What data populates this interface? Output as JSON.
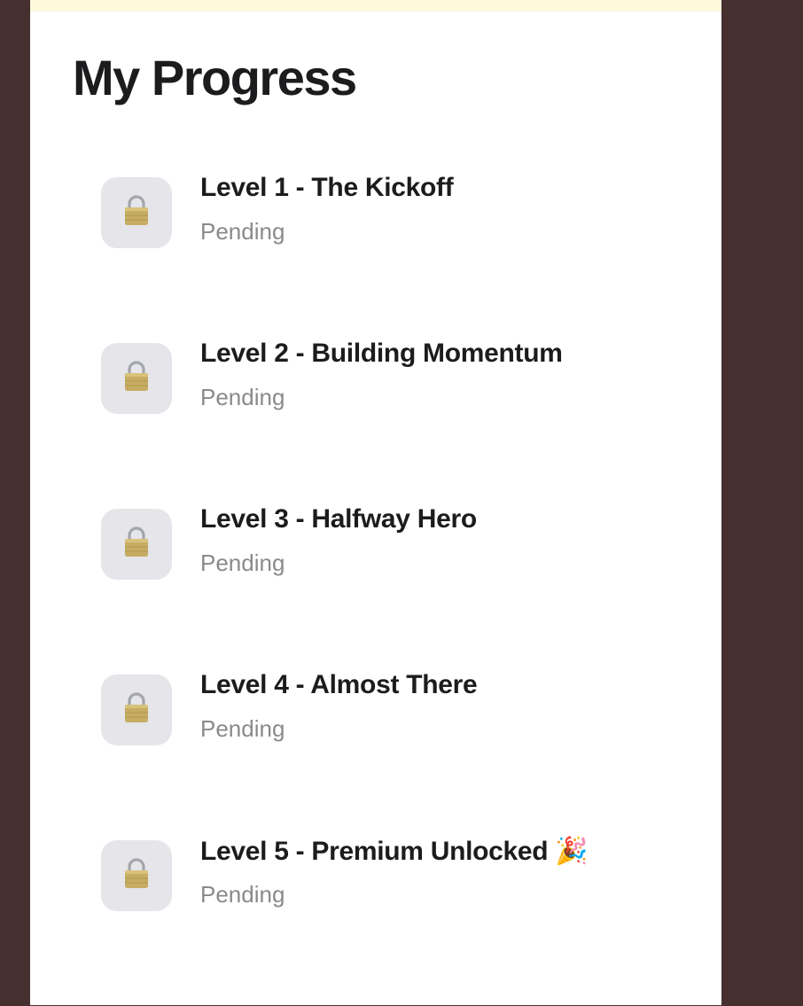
{
  "page": {
    "title": "My Progress"
  },
  "levels": [
    {
      "title": "Level 1 - The Kickoff",
      "status": "Pending",
      "icon": "lock-icon"
    },
    {
      "title": "Level 2 - Building Momentum",
      "status": "Pending",
      "icon": "lock-icon"
    },
    {
      "title": "Level 3 - Halfway Hero",
      "status": "Pending",
      "icon": "lock-icon"
    },
    {
      "title": "Level 4 - Almost There",
      "status": "Pending",
      "icon": "lock-icon"
    },
    {
      "title": "Level 5 - Premium Unlocked 🎉",
      "status": "Pending",
      "icon": "lock-icon"
    }
  ],
  "colors": {
    "background": "#45302f",
    "panel": "#ffffff",
    "top_strip": "#fff9dc",
    "icon_tile": "#e5e5ea",
    "title_text": "#1c1c1e",
    "status_text": "#8a8a8e"
  }
}
